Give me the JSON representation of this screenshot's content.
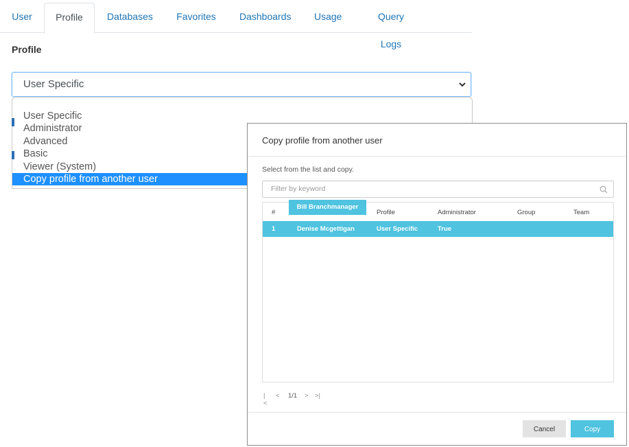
{
  "tabs": [
    {
      "label": "User"
    },
    {
      "label": "Profile"
    },
    {
      "label": "Databases"
    },
    {
      "label": "Favorites"
    },
    {
      "label": "Dashboards"
    },
    {
      "label": "Usage"
    },
    {
      "label": "Query Logs"
    }
  ],
  "active_tab": "Profile",
  "section_title": "Profile",
  "profile_select": {
    "value": "User Specific",
    "options": [
      {
        "label": "User Specific"
      },
      {
        "label": "Administrator"
      },
      {
        "label": "Advanced"
      },
      {
        "label": "Basic"
      },
      {
        "label": "Viewer (System)"
      },
      {
        "label": "Copy profile from another user"
      }
    ],
    "selected_option": "Copy profile from another user"
  },
  "modal": {
    "title": "Copy profile from another user",
    "hint": "Select from the list and copy.",
    "filter_placeholder": "Filter by keyword",
    "columns": {
      "num": "#",
      "name": "Bill Branchmanager",
      "profile": "Profile",
      "admin": "Administrator",
      "group": "Group",
      "team": "Team"
    },
    "rows": [
      {
        "num": "1",
        "name": "Denise Mcgettigan",
        "profile": "User Specific",
        "admin": "True",
        "group": "",
        "team": ""
      }
    ],
    "pager": {
      "first": "|<",
      "prev": "<",
      "page": "1/1",
      "next": ">",
      "last": ">|"
    },
    "cancel_label": "Cancel",
    "copy_label": "Copy"
  },
  "colors": {
    "accent": "#4fc3df",
    "link": "#1f75b6",
    "select_highlight": "#1e90ff"
  }
}
